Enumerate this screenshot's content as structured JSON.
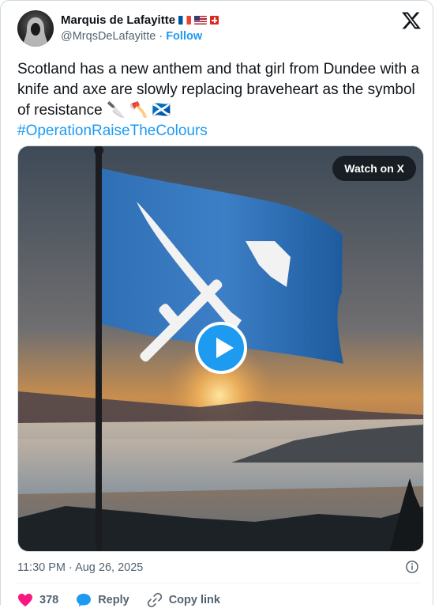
{
  "author": {
    "name": "Marquis de Lafayitte",
    "handle": "@MrqsDeLafayitte",
    "separator": "·",
    "follow_label": "Follow",
    "name_flags": [
      "france-flag-icon",
      "us-flag-icon",
      "swiss-flag-icon"
    ]
  },
  "tweet": {
    "text": "Scotland has a new anthem and that girl from Dundee with a knife and axe are slowly replacing braveheart as the symbol of resistance 🔪 🪓 🏴󠁧󠁢󠁳󠁣󠁴󠁿",
    "hashtag": "#OperationRaiseTheColours"
  },
  "media": {
    "watch_label": "Watch on X",
    "play_icon": "play-icon"
  },
  "timestamp": "11:30 PM · Aug 26, 2025",
  "actions": {
    "likes": "378",
    "reply_label": "Reply",
    "copy_label": "Copy link"
  },
  "colors": {
    "accent": "#1d9bf0",
    "like": "#f91880",
    "text": "#0f1419",
    "muted": "#536471",
    "flag_blue": "#2f6fb5"
  }
}
